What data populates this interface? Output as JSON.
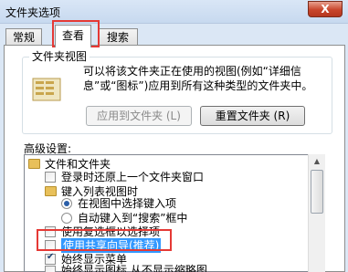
{
  "window": {
    "title": "文件夹选项",
    "close_label": "X"
  },
  "tabs": [
    {
      "label": "常规"
    },
    {
      "label": "查看"
    },
    {
      "label": "搜索"
    }
  ],
  "folder_views": {
    "title": "文件夹视图",
    "description": "可以将该文件夹正在使用的视图(例如“详细信息”或“图标”)应用到所有这种类型的文件夹中。",
    "apply_button": "应用到文件夹 (L)",
    "reset_button": "重置文件夹 (R)"
  },
  "advanced": {
    "label": "高级设置:",
    "items": [
      {
        "text": "文件和文件夹",
        "type": "folder"
      },
      {
        "text": "登录时还原上一个文件夹窗口",
        "type": "checkbox",
        "checked": false
      },
      {
        "text": "键入列表视图时",
        "type": "folder"
      },
      {
        "text": "在视图中选择键入项",
        "type": "radio",
        "checked": true
      },
      {
        "text": "自动键入到“搜索”框中",
        "type": "radio",
        "checked": false
      },
      {
        "text": "使用复选框以选择项",
        "type": "checkbox",
        "checked": false
      },
      {
        "text": "使用共享向导(推荐)",
        "type": "checkbox",
        "checked": false,
        "selected": true
      },
      {
        "text": "始终显示菜单",
        "type": "checkbox",
        "checked": true
      },
      {
        "text": "始终显示图标,从不显示缩略图",
        "type": "checkbox",
        "checked": false
      }
    ]
  },
  "colors": {
    "highlight_box": "#e53935",
    "selection": "#3399ff"
  }
}
